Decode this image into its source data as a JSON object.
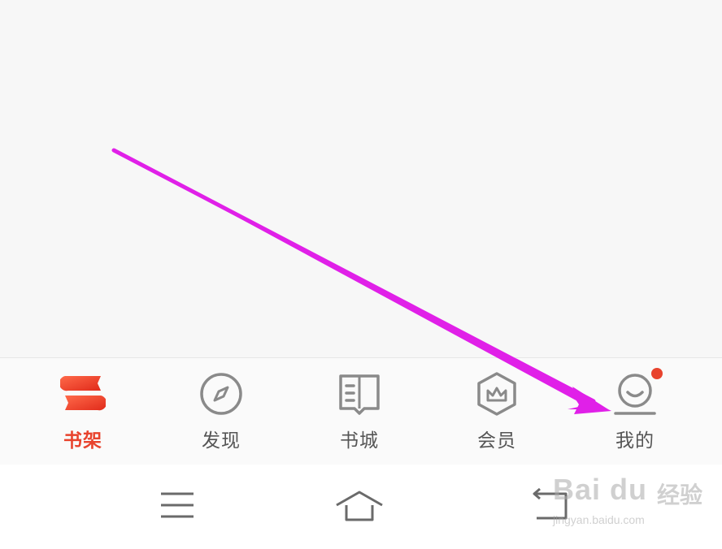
{
  "tab_bar": {
    "tabs": [
      {
        "id": "shelf",
        "label": "书架",
        "icon": "bookshelf-icon",
        "active": true
      },
      {
        "id": "discover",
        "label": "发现",
        "icon": "compass-icon",
        "active": false
      },
      {
        "id": "store",
        "label": "书城",
        "icon": "open-book-icon",
        "active": false
      },
      {
        "id": "member",
        "label": "会员",
        "icon": "crown-hexagon-icon",
        "active": false
      },
      {
        "id": "mine",
        "label": "我的",
        "icon": "smiley-profile-icon",
        "active": false,
        "has_badge": true
      }
    ],
    "active_color": "#e8432d",
    "inactive_color": "#555555"
  },
  "system_nav": {
    "buttons": [
      "menu-icon",
      "home-icon",
      "back-icon"
    ]
  },
  "annotation": {
    "type": "arrow",
    "color": "#e020e8"
  },
  "watermark": {
    "brand": "Bai du",
    "cn": "经验",
    "url": "jingyan.baidu.com"
  }
}
